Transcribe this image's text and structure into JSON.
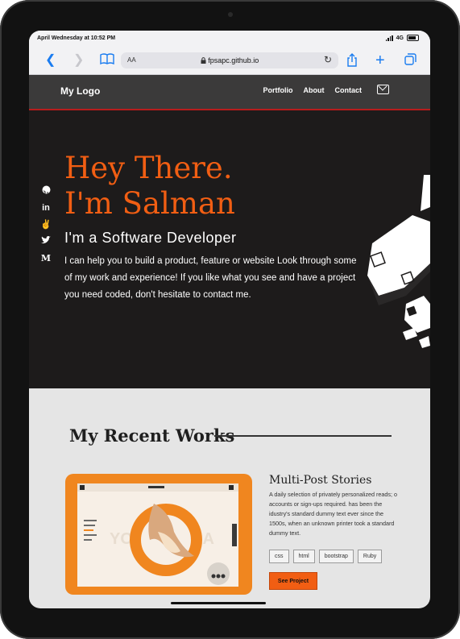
{
  "status": {
    "time": "April Wednesday at 10:52 PM",
    "network": "4G"
  },
  "browser": {
    "url": "fpsapc.github.io",
    "text_size": "AA"
  },
  "icons": {
    "back": "chevron-left-icon",
    "forward": "chevron-right-icon",
    "bookmarks": "book-icon",
    "lock": "lock-icon",
    "reload": "reload-icon",
    "share": "share-icon",
    "new_tab": "plus-icon",
    "tabs": "tabs-icon",
    "socials": [
      "github-icon",
      "linkedin-icon",
      "angellist-icon",
      "twitter-icon",
      "medium-icon"
    ],
    "mail": "mail-icon"
  },
  "nav": {
    "logo": "My Logo",
    "links": [
      "Portfolio",
      "About",
      "Contact"
    ]
  },
  "hero": {
    "greeting_line1": "Hey There.",
    "greeting_line2": "I'm Salman",
    "role": "I'm a Software Developer",
    "bio": "I can help you to build a product, feature or website Look through some of my work and experience! If you like what you see and have a project you need coded, don't hesitate to contact me."
  },
  "works": {
    "title": "My Recent Works",
    "project": {
      "title": "Multi-Post Stories",
      "description": "A daily selection of privately personalized reads; o accounts or sign-ups required. has been the idustry's standard dummy text ever since the 1500s, when an unknown printer took a standard dummy text.",
      "tags": [
        "css",
        "html",
        "bootstrap",
        "Ruby"
      ],
      "button": "See Project"
    }
  },
  "colors": {
    "accent": "#f15e13",
    "hero_bg": "#1d1b1b",
    "nav_bg": "#3b3a3a",
    "section_bg": "#e5e5e5",
    "link_blue": "#1a7cf0"
  }
}
